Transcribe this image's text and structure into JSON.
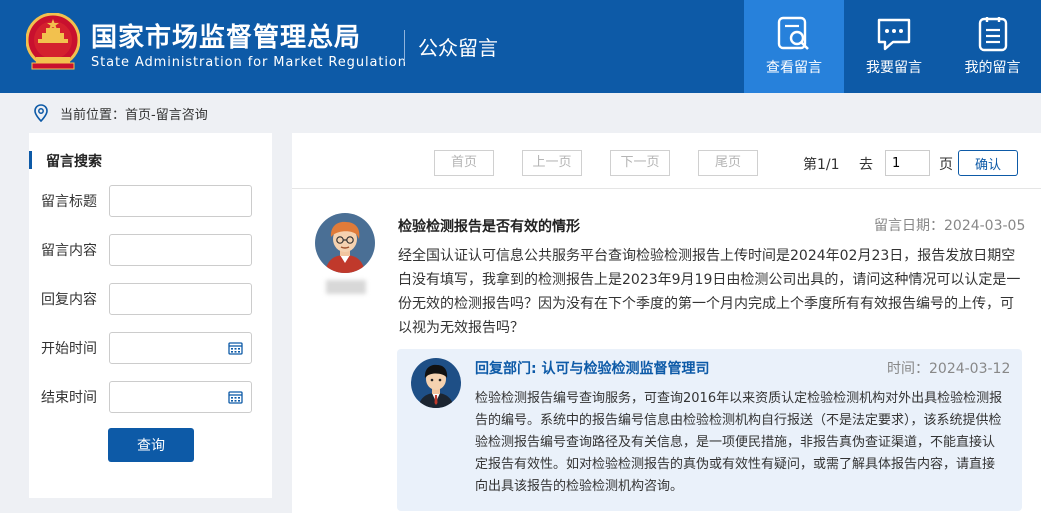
{
  "header": {
    "title_cn": "国家市场监督管理总局",
    "title_en": "State Administration for Market Regulation",
    "section": "公众留言",
    "nav": [
      {
        "label": "查看留言",
        "icon": "search-document-icon",
        "active": true
      },
      {
        "label": "我要留言",
        "icon": "chat-bubble-icon",
        "active": false
      },
      {
        "label": "我的留言",
        "icon": "list-document-icon",
        "active": false
      }
    ]
  },
  "breadcrumb": {
    "text": "当前位置：首页-留言咨询",
    "icon": "location-pin-icon"
  },
  "search_panel": {
    "title": "留言搜索",
    "fields": [
      {
        "label": "留言标题",
        "value": ""
      },
      {
        "label": "留言内容",
        "value": ""
      },
      {
        "label": "回复内容",
        "value": ""
      },
      {
        "label": "开始时间",
        "value": "",
        "icon": "calendar-icon"
      },
      {
        "label": "结束时间",
        "value": "",
        "icon": "calendar-icon"
      }
    ],
    "submit": "查询"
  },
  "pager": {
    "first": "首页",
    "prev": "上一页",
    "next": "下一页",
    "last": "尾页",
    "status": "第1/1",
    "goto": "去",
    "page_value": "1",
    "page_unit": "页",
    "confirm": "确认"
  },
  "message": {
    "title": "检验检测报告是否有效的情形",
    "date": "留言日期：2024-03-05",
    "body": "经全国认证认可信息公共服务平台查询检验检测报告上传时间是2024年02月23日，报告发放日期空白没有填写，我拿到的检测报告上是2023年9月19日由检测公司出具的，请问这种情况可以认定是一份无效的检测报告吗？因为没有在下个季度的第一个月内完成上个季度所有有效报告编号的上传，可以视为无效报告吗？"
  },
  "reply": {
    "dept": "回复部门: 认可与检验检测监督管理司",
    "time": "时间：2024-03-12",
    "body": "检验检测报告编号查询服务，可查询2016年以来资质认定检验检测机构对外出具检验检测报告的编号。系统中的报告编号信息由检验检测机构自行报送（不是法定要求），该系统提供检验检测报告编号查询路径及有关信息，是一项便民措施，非报告真伪查证渠道，不能直接认定报告有效性。如对检验检测报告的真伪或有效性有疑问，或需了解具体报告内容，请直接向出具该报告的检验检测机构咨询。"
  },
  "colors": {
    "brand": "#0d5aa7",
    "nav_active": "#2781db",
    "reply_bg": "#eaf1fa",
    "page_bg": "#eef0f4"
  }
}
